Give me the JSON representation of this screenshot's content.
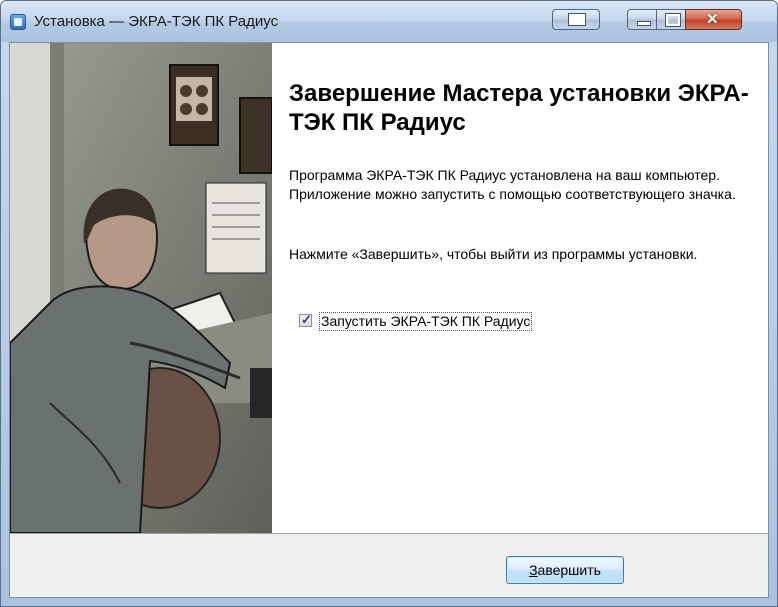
{
  "window": {
    "title": "Установка — ЭКРА-ТЭК ПК Радиус"
  },
  "wizard": {
    "heading": "Завершение Мастера установки ЭКРА-ТЭК ПК Радиус",
    "paragraph1": "Программа ЭКРА-ТЭК ПК Радиус установлена на ваш компьютер. Приложение можно запустить с помощью соответствующего значка.",
    "paragraph2": "Нажмите «Завершить», чтобы выйти из программы установки.",
    "launch_checkbox": {
      "label": "Запустить ЭКРА-ТЭК ПК Радиус",
      "checked": true
    }
  },
  "footer": {
    "finish_accel": "З",
    "finish_rest": "авершить"
  },
  "icons": {
    "app": "installer-icon",
    "snap": "snap-window-icon",
    "minimize": "minimize-icon",
    "maximize": "maximize-icon",
    "close": "close-icon"
  },
  "colors": {
    "titlebar": "#b4cbe5",
    "close_button": "#c0432a",
    "finish_button_border": "#3c7fb1"
  }
}
